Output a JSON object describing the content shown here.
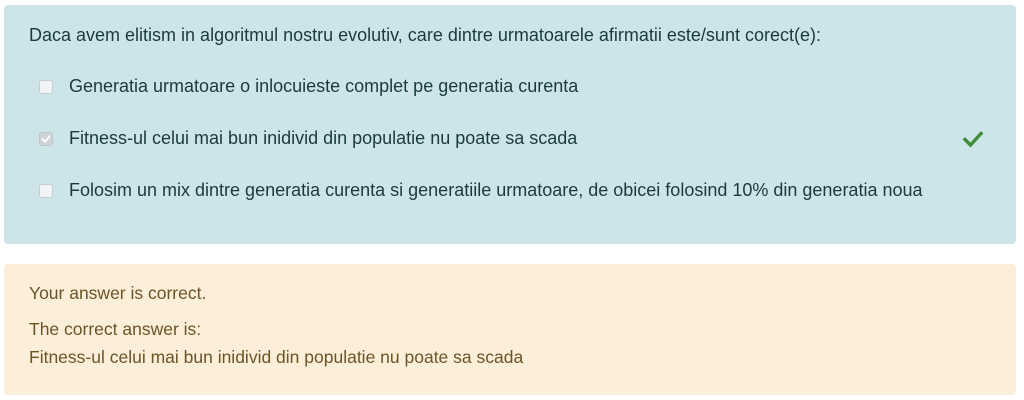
{
  "question": {
    "text": "Daca avem elitism in algoritmul nostru evolutiv, care dintre urmatoarele afirmatii este/sunt corect(e):",
    "options": [
      {
        "label": "Generatia urmatoare o inlocuieste complet pe generatia curenta",
        "checked": false
      },
      {
        "label": "Fitness-ul celui mai bun inidivid din populatie nu poate sa scada",
        "checked": true,
        "status_icon": "check-icon"
      },
      {
        "label": "Folosim un mix dintre generatia curenta si generatiile urmatoare, de obicei folosind 10% din generatia noua",
        "checked": false
      }
    ]
  },
  "feedback": {
    "result": "Your answer is correct.",
    "correct_answer_label": "The correct answer is:",
    "correct_answer": "Fitness-ul celui mai bun inidivid din populatie nu poate sa scada"
  },
  "colors": {
    "question_bg": "#cde5e9",
    "feedback_bg": "#fcefd9",
    "correct_check": "#3f8f3a"
  }
}
